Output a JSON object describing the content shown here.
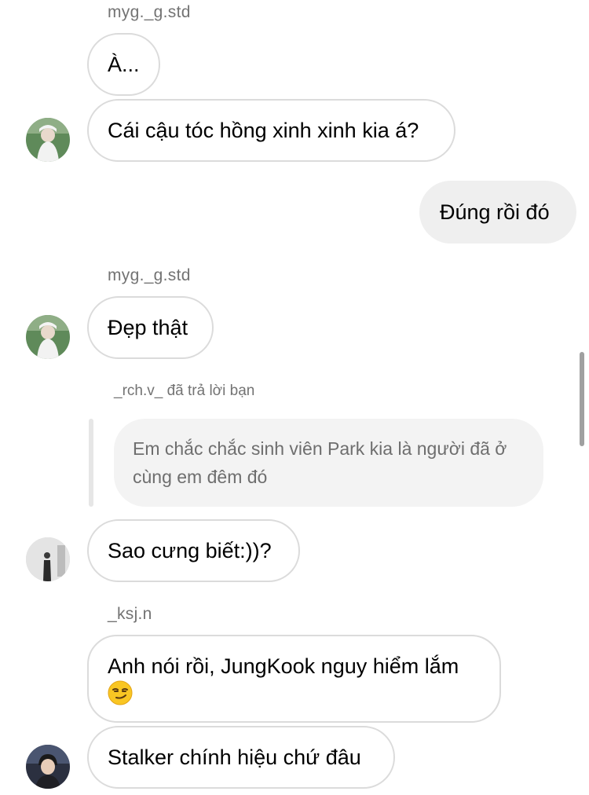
{
  "messages": [
    {
      "sender": "myg._g.std",
      "text": "À..."
    },
    {
      "text": "Cái cậu tóc hồng xinh xinh kia á?"
    },
    {
      "text": "Đúng rồi đó",
      "mine": true
    },
    {
      "sender": "myg._g.std",
      "text": "Đẹp thật"
    },
    {
      "reply_label": "_rch.v_ đã trả lời bạn",
      "quoted_text": "Em chắc chắc sinh viên Park kia là người đã ở cùng em đêm đó"
    },
    {
      "text": "Sao cưng biết:))?"
    },
    {
      "sender": "_ksj.n",
      "text": "Anh nói rồi, JungKook nguy hiểm lắm",
      "emoji": "smirking-face"
    },
    {
      "text": "Stalker chính hiệu chứ đâu"
    }
  ],
  "colors": {
    "bubble_border": "#dbdbdb",
    "mine_bubble": "#efefef",
    "meta_text": "#737373",
    "quote_bg": "#f3f3f3"
  }
}
